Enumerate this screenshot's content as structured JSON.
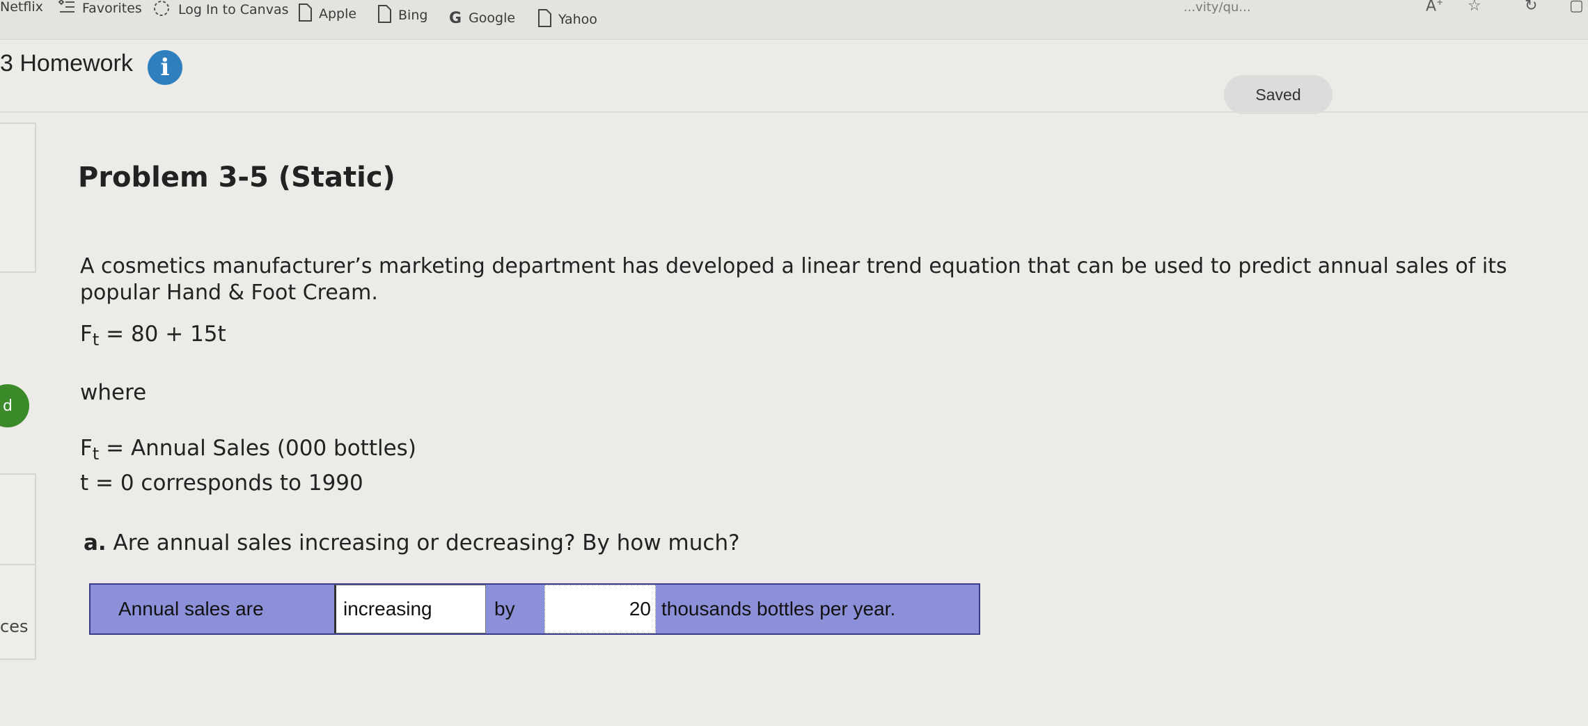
{
  "bookmarks": [
    {
      "label": "Netflix",
      "icon": "none"
    },
    {
      "label": "Favorites",
      "icon": "favorites-list-icon"
    },
    {
      "label": "Log In to Canvas",
      "icon": "canvas-icon"
    },
    {
      "label": "Apple",
      "icon": "page-icon"
    },
    {
      "label": "Bing",
      "icon": "page-icon"
    },
    {
      "label": "Google",
      "icon": "google-g-icon"
    },
    {
      "label": "Yahoo",
      "icon": "page-icon"
    }
  ],
  "url_fragment": "...vity/qu...",
  "header": {
    "title": "3 Homework",
    "info_icon": "i",
    "saved_label": "Saved"
  },
  "sidebar": {
    "pill_text": "d",
    "cut_text": "ces"
  },
  "problem": {
    "title": "Problem 3-5 (Static)",
    "intro": "A cosmetics manufacturer’s marketing department has developed a linear trend equation that can be used to predict annual sales of its popular Hand & Foot Cream.",
    "equation_lhs": "F",
    "equation_sub": "t",
    "equation_rhs": " = 80 + 15t",
    "where": "where",
    "def1_lhs": "F",
    "def1_sub": "t",
    "def1_rhs": " = Annual Sales (000 bottles)",
    "def2": "t = 0 corresponds to 1990",
    "question_letter": "a.",
    "question_text": " Are annual sales increasing or decreasing? By how much?"
  },
  "answer": {
    "label1": "Annual sales are",
    "select_value": "increasing",
    "label2": "by",
    "amount_value": "20",
    "label3": "thousands bottles per year."
  },
  "colors": {
    "answer_label_bg": "#8b90d8",
    "info_icon": "#2f7fbf",
    "green_pill": "#3b8a2a"
  }
}
